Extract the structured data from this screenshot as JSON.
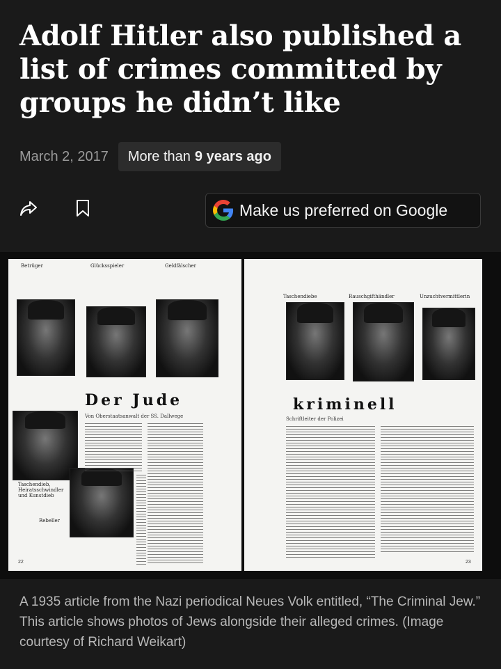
{
  "article": {
    "headline": "Adolf Hitler also published a list of crimes committed by groups he didn’t like",
    "date": "March 2, 2017",
    "age_prefix": "More than",
    "age_value": "9 years ago"
  },
  "actions": {
    "share_icon": "share-icon",
    "bookmark_icon": "bookmark-icon",
    "google_button_label": "Make us preferred on Google",
    "google_icon": "google-g-icon"
  },
  "scan": {
    "left_labels": [
      "Betrüger",
      "Glücksspieler",
      "Geldfälscher"
    ],
    "left_title": "Der Jude",
    "left_byline": "Von Oberstaatsanwalt der SS. Dallwege",
    "left_caption": "Taschendieb, Heiratsschwindler und Kunstdieb",
    "left_caption2": "Rebeller",
    "left_pagenum": "22",
    "right_labels": [
      "Taschendiebe",
      "Rauschgifthändler",
      "Unzuchtvermittlerin"
    ],
    "right_title": "kriminell",
    "right_byline": "Schriftleiter der Polizei",
    "right_pagenum": "23"
  },
  "caption": "A 1935 article from the Nazi periodical Neues Volk entitled, “The Criminal Jew.” This article shows photos of Jews alongside their alleged crimes. (Image courtesy of Richard Weikart)",
  "colors": {
    "background": "#1a1a1a",
    "badge": "#2c2c2c",
    "caption_text": "#b8b8b8",
    "date_text": "#9a9a9a"
  }
}
